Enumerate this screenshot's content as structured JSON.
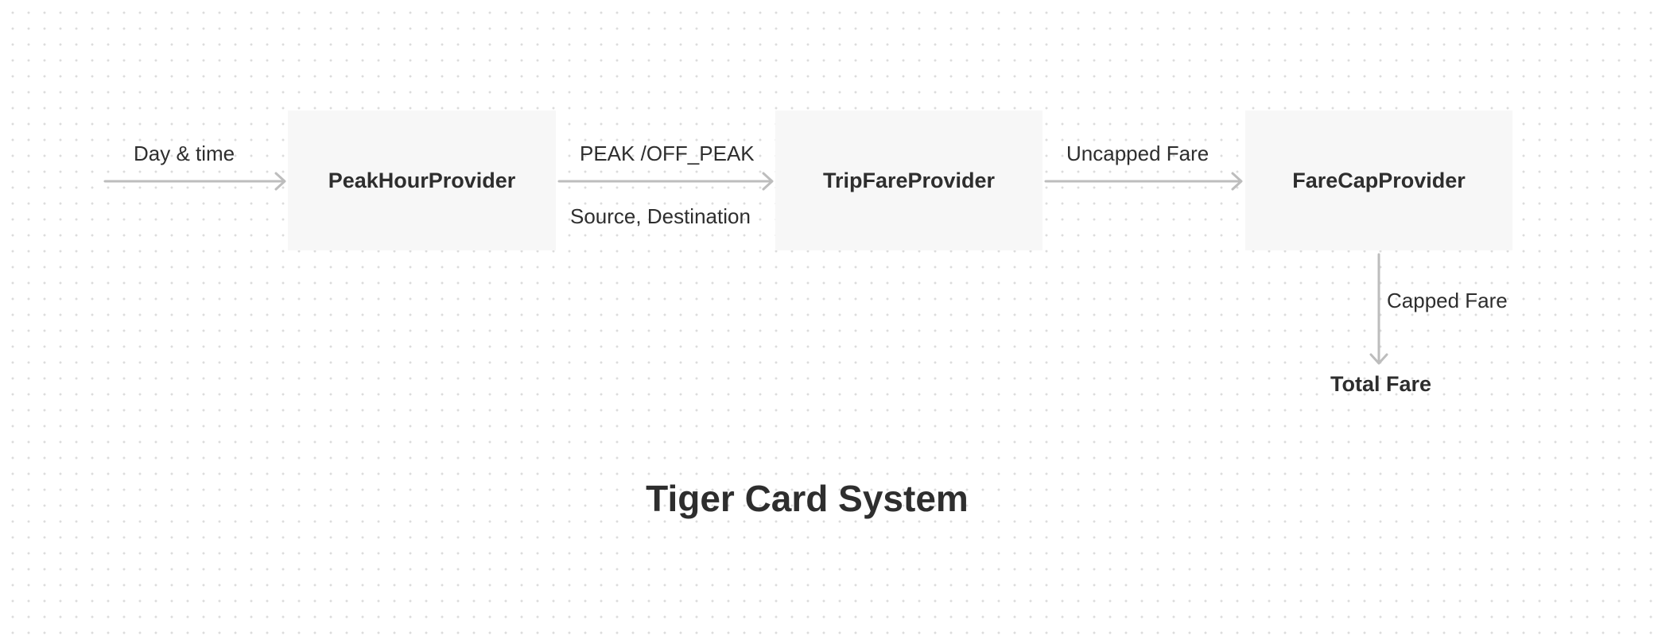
{
  "diagram": {
    "title": "Tiger Card System",
    "nodes": {
      "peak_hour_provider": "PeakHourProvider",
      "trip_fare_provider": "TripFareProvider",
      "fare_cap_provider": "FareCapProvider"
    },
    "edge_labels": {
      "day_time": "Day & time",
      "peak_off_peak": "PEAK /OFF_PEAK",
      "source_destination": "Source, Destination",
      "uncapped_fare": "Uncapped Fare",
      "capped_fare": "Capped Fare"
    },
    "output": "Total Fare"
  },
  "colors": {
    "node_fill": "#f7f7f7",
    "arrow": "#bdbdbd",
    "text": "#2e2e2e",
    "grid_dot": "#dcdcdc"
  }
}
